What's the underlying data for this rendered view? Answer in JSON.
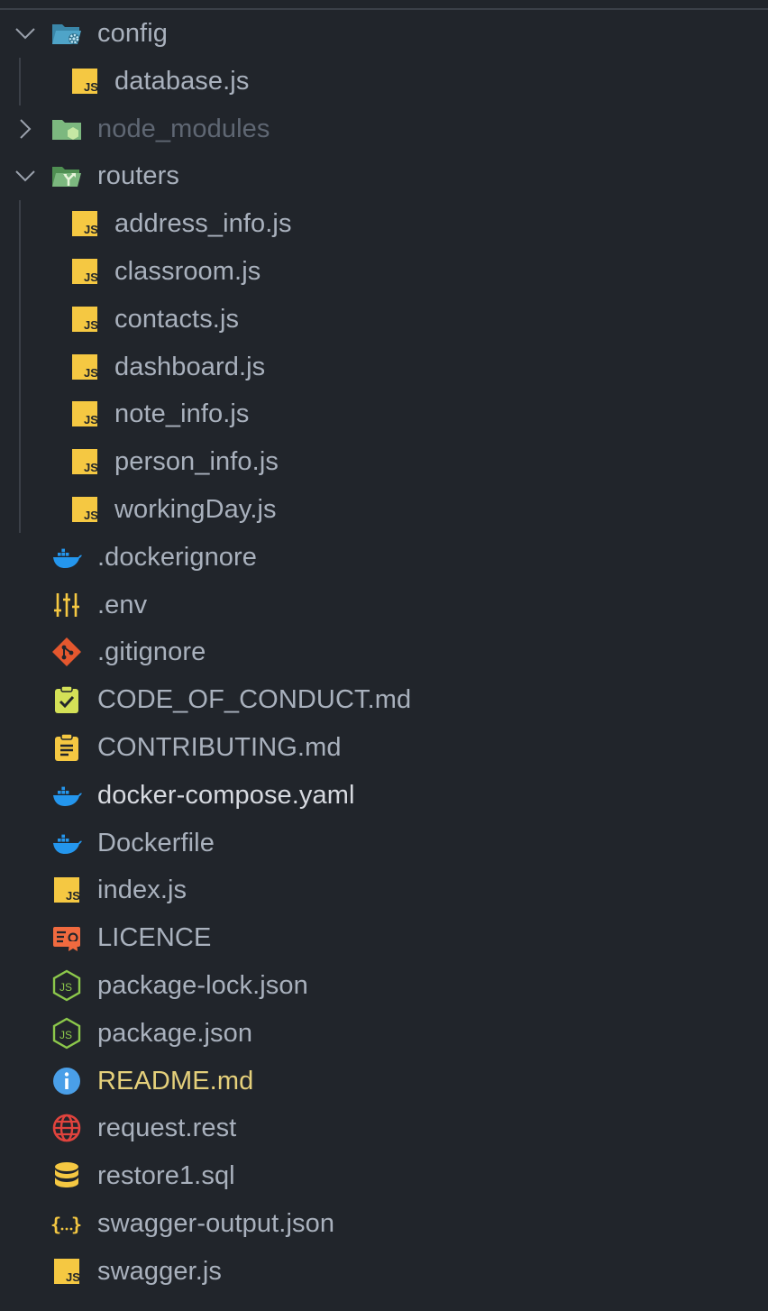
{
  "explorer": {
    "folders": {
      "config": {
        "label": "config",
        "icon": "folder-config-open-icon"
      },
      "node_modules": {
        "label": "node_modules",
        "icon": "folder-node-closed-icon"
      },
      "routers": {
        "label": "routers",
        "icon": "folder-routes-open-icon"
      }
    },
    "config_children": [
      {
        "label": "database.js",
        "icon": "javascript-file-icon"
      }
    ],
    "routers_children": [
      {
        "label": "address_info.js",
        "icon": "javascript-file-icon"
      },
      {
        "label": "classroom.js",
        "icon": "javascript-file-icon"
      },
      {
        "label": "contacts.js",
        "icon": "javascript-file-icon"
      },
      {
        "label": "dashboard.js",
        "icon": "javascript-file-icon"
      },
      {
        "label": "note_info.js",
        "icon": "javascript-file-icon"
      },
      {
        "label": "person_info.js",
        "icon": "javascript-file-icon"
      },
      {
        "label": "workingDay.js",
        "icon": "javascript-file-icon"
      }
    ],
    "root_files": [
      {
        "label": ".dockerignore",
        "icon": "docker-icon"
      },
      {
        "label": ".env",
        "icon": "env-settings-icon"
      },
      {
        "label": ".gitignore",
        "icon": "git-icon"
      },
      {
        "label": "CODE_OF_CONDUCT.md",
        "icon": "code-of-conduct-icon"
      },
      {
        "label": "CONTRIBUTING.md",
        "icon": "contributing-icon"
      },
      {
        "label": "docker-compose.yaml",
        "icon": "docker-icon"
      },
      {
        "label": "Dockerfile",
        "icon": "docker-icon"
      },
      {
        "label": "index.js",
        "icon": "javascript-file-icon"
      },
      {
        "label": "LICENCE",
        "icon": "license-icon"
      },
      {
        "label": "package-lock.json",
        "icon": "nodejs-icon"
      },
      {
        "label": "package.json",
        "icon": "nodejs-icon"
      },
      {
        "label": "README.md",
        "icon": "info-icon"
      },
      {
        "label": "request.rest",
        "icon": "globe-icon"
      },
      {
        "label": "restore1.sql",
        "icon": "database-icon"
      },
      {
        "label": "swagger-output.json",
        "icon": "json-braces-icon"
      },
      {
        "label": "swagger.js",
        "icon": "javascript-file-icon"
      }
    ]
  },
  "colors": {
    "background": "#21252b",
    "text": "#a9b1bd",
    "text_dimmed": "#5f6773",
    "text_bright": "#d7dae0",
    "text_modified": "#e5d07b",
    "js_yellow": "#f5c842",
    "docker_blue": "#2496ed",
    "folder_config": "#4fa4c8",
    "folder_green": "#7cb87f",
    "git_orange": "#e4572e",
    "node_green": "#8cc84b"
  }
}
